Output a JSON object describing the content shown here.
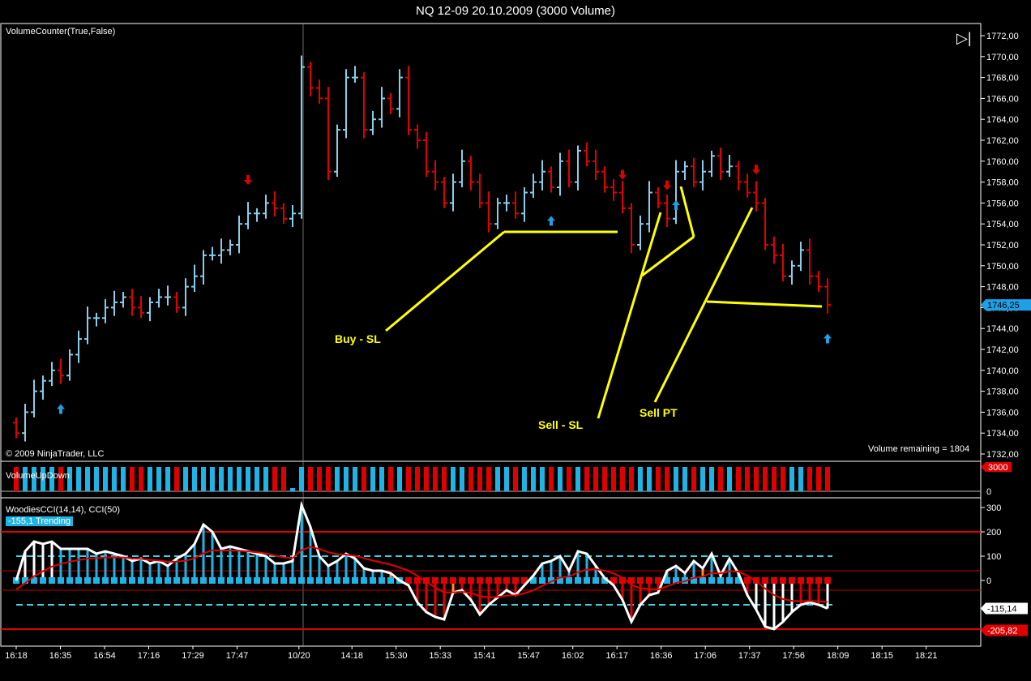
{
  "window_title": "NQ 12-09  20.10.2009 (3000 Volume)",
  "colors": {
    "up": "#87ceeb",
    "down": "#e00000",
    "arrow_up": "#1ea0e6",
    "arrow_down": "#e00000",
    "annotation": "#ffff00",
    "cci_line": "#ffffff",
    "cci50_line": "#e00000",
    "volume_up": "#1eb4e6",
    "volume_down": "#e00000"
  },
  "indicators": {
    "price_label": "VolumeCounter(True,False)",
    "copyright": "© 2009 NinjaTrader, LLC",
    "volume_remaining": "Volume remaining = 1804",
    "volume_label": "VolumeUpDown",
    "cci_label": "WoodiesCCI(14,14), CCI(50)",
    "cci_badge": "-155,1 Trending"
  },
  "annotations": {
    "buy_sl": "Buy - SL",
    "sell_sl": "Sell - SL",
    "sell_pt": "Sell PT"
  },
  "chart_data": [
    {
      "type": "ohlc",
      "title": "NQ 12-09 20.10.2009 (3000 Volume)",
      "ylim": [
        1731,
        1773
      ],
      "y_ticks": [
        "1772,00",
        "1770,00",
        "1768,00",
        "1766,00",
        "1764,00",
        "1762,00",
        "1760,00",
        "1758,00",
        "1756,00",
        "1754,00",
        "1752,00",
        "1750,00",
        "1748,00",
        "1746,00",
        "1744,00",
        "1742,00",
        "1740,00",
        "1738,00",
        "1736,00",
        "1734,00",
        "1732,00"
      ],
      "last_price": "1746,25",
      "x_ticks": [
        {
          "bar": 0,
          "label": "16:18"
        },
        {
          "bar": 5,
          "label": "16:35"
        },
        {
          "bar": 10,
          "label": "16:54"
        },
        {
          "bar": 15,
          "label": "17:16"
        },
        {
          "bar": 20,
          "label": "17:29"
        },
        {
          "bar": 25,
          "label": "17:47"
        },
        {
          "bar": 32,
          "label": "10/20"
        },
        {
          "bar": 38,
          "label": "14:18"
        },
        {
          "bar": 43,
          "label": "15:30"
        },
        {
          "bar": 48,
          "label": "15:33"
        },
        {
          "bar": 53,
          "label": "15:41"
        },
        {
          "bar": 58,
          "label": "15:47"
        },
        {
          "bar": 63,
          "label": "16:02"
        },
        {
          "bar": 68,
          "label": "16:17"
        },
        {
          "bar": 73,
          "label": "16:36"
        },
        {
          "bar": 78,
          "label": "17:06"
        },
        {
          "bar": 83,
          "label": "17:37"
        },
        {
          "bar": 88,
          "label": "17:56"
        },
        {
          "bar": 93,
          "label": "18:09"
        },
        {
          "bar": 98,
          "label": "18:15"
        },
        {
          "bar": 103,
          "label": "18:21"
        }
      ],
      "open_first": 1735,
      "close": [
        1734,
        1736,
        1738,
        1739,
        1740,
        1739.5,
        1741.5,
        1743,
        1745,
        1745,
        1746,
        1746.5,
        1747,
        1746,
        1745.5,
        1746.5,
        1747,
        1747,
        1746,
        1748,
        1749,
        1751,
        1751,
        1751.5,
        1752,
        1754,
        1755,
        1755,
        1756,
        1755.5,
        1754.5,
        1755,
        1769,
        1767,
        1766,
        1759,
        1763,
        1768,
        1768,
        1763,
        1764,
        1766,
        1765,
        1768,
        1763,
        1762,
        1759,
        1758,
        1756,
        1758,
        1760,
        1758,
        1756,
        1754,
        1756,
        1756,
        1755,
        1757,
        1758,
        1759,
        1757.5,
        1760,
        1758,
        1761,
        1760,
        1759,
        1757.5,
        1757,
        1755.5,
        1752,
        1754,
        1757,
        1756,
        1754.5,
        1759,
        1759.5,
        1758,
        1759,
        1760.5,
        1759,
        1759.5,
        1758,
        1757,
        1756,
        1752,
        1751,
        1749,
        1750,
        1751.5,
        1749,
        1748,
        1746.25
      ],
      "arrows": [
        {
          "bar": 5,
          "dir": "up"
        },
        {
          "bar": 26,
          "dir": "down"
        },
        {
          "bar": 60,
          "dir": "up"
        },
        {
          "bar": 68,
          "dir": "down"
        },
        {
          "bar": 73,
          "dir": "down"
        },
        {
          "bar": 74,
          "dir": "up"
        },
        {
          "bar": 83,
          "dir": "down"
        },
        {
          "bar": 91,
          "dir": "up"
        }
      ]
    },
    {
      "type": "bar",
      "title": "VolumeUpDown",
      "ylim": [
        0,
        3000
      ],
      "y_ticks": [
        "0"
      ],
      "last_value": "3000",
      "values_note": "each bar 3000 except last of session",
      "partial_bar": {
        "bar": 31,
        "value": 400
      }
    },
    {
      "type": "line",
      "title": "WoodiesCCI(14,14), CCI(50)",
      "ylim": [
        -230,
        330
      ],
      "y_ticks": [
        "300",
        "200",
        "100",
        "0"
      ],
      "levels": [
        200,
        100,
        0,
        -100,
        -200
      ],
      "last_cci": "-115,14",
      "last_cci50": "-205,82",
      "cci": [
        0,
        120,
        160,
        150,
        160,
        130,
        130,
        130,
        130,
        110,
        120,
        110,
        100,
        80,
        90,
        70,
        80,
        60,
        90,
        110,
        150,
        230,
        200,
        130,
        140,
        130,
        120,
        110,
        100,
        70,
        70,
        80,
        310,
        220,
        100,
        60,
        80,
        110,
        90,
        50,
        40,
        40,
        30,
        0,
        -20,
        -90,
        -130,
        -150,
        -160,
        -50,
        -40,
        -80,
        -140,
        -100,
        -70,
        -40,
        -60,
        -20,
        20,
        70,
        80,
        100,
        40,
        120,
        110,
        60,
        10,
        -20,
        -80,
        -170,
        -100,
        -60,
        -50,
        40,
        60,
        30,
        80,
        50,
        110,
        20,
        90,
        30,
        -60,
        -120,
        -190,
        -200,
        -170,
        -130,
        -100,
        -90,
        -100,
        -115
      ]
    }
  ]
}
